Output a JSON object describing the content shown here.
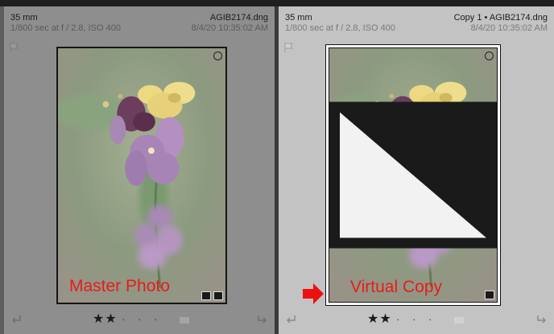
{
  "master": {
    "focal_length": "35 mm",
    "filename": "AGIB2174.dng",
    "exposure": "1/800 sec at f / 2.8, ISO 400",
    "datetime": "8/4/20 10:35:02 AM",
    "overlay_label": "Master Photo",
    "rating_stars": "★★",
    "rating_dots": "· · ·"
  },
  "virtual": {
    "focal_length": "35 mm",
    "copy_name": "Copy 1",
    "separator": "•",
    "filename": "AGIB2174.dng",
    "exposure": "1/800 sec at f / 2.8, ISO 400",
    "datetime": "8/4/20 10:35:02 AM",
    "overlay_label": "Virtual Copy",
    "rating_stars": "★★",
    "rating_dots": "· · ·"
  },
  "colors": {
    "annotation_red": "#e81b1b",
    "master_bg": "#8e8e8e",
    "virtual_bg": "#c3c3c3"
  }
}
